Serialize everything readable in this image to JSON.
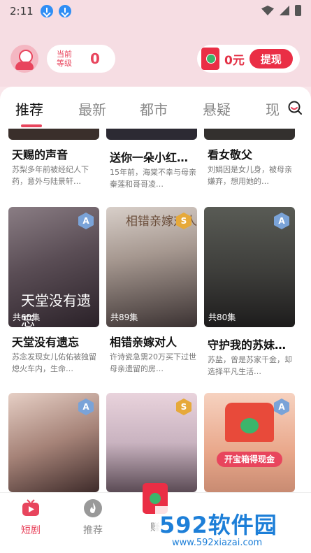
{
  "status_bar": {
    "time": "2:11"
  },
  "header": {
    "level_label": "当前等级",
    "level_value": "0",
    "wallet_amount": "0元",
    "withdraw_label": "提现"
  },
  "tabs": [
    "推荐",
    "最新",
    "都市",
    "悬疑",
    "现"
  ],
  "cards_top": [
    {
      "title": "天赐的声音",
      "desc": "苏梨多年前被经纪人下药，意外与陆景轩…"
    },
    {
      "title": "送你一朵小红…",
      "desc": "15年前，海棠不幸与母亲秦莲和哥哥凌…"
    },
    {
      "title": "看女敬父",
      "desc": "刘娟因是女儿身，被母亲嫌弃，想用她的…"
    }
  ],
  "cards_mid": [
    {
      "title": "天堂没有遗忘",
      "desc": "苏念发现女儿佑佑被独留熄火车内，生命…",
      "episodes": "共60集",
      "badge": "A",
      "overlay": "天堂没有遗忘"
    },
    {
      "title": "相错亲嫁对人",
      "desc": "许诗瓷急需20万买下过世母亲遗留的房…",
      "episodes": "共89集",
      "badge": "S",
      "overlay": "相错亲嫁对人"
    },
    {
      "title": "守护我的苏妹…",
      "desc": "苏盐，曾是苏家千金，却选择平凡生活…",
      "episodes": "共80集",
      "badge": "A",
      "overlay": ""
    }
  ],
  "cards_bottom": [
    {
      "badge": "A"
    },
    {
      "badge": "S"
    },
    {
      "badge": "A",
      "promo": "开宝箱得现金"
    }
  ],
  "bottom_nav": [
    {
      "label": "短剧",
      "icon": "tv-icon"
    },
    {
      "label": "推荐",
      "icon": "flame-icon"
    },
    {
      "label": "赚",
      "icon": "redpacket-icon"
    }
  ],
  "watermark": {
    "main": "592软件园",
    "sub": "www.592xiazai.com"
  },
  "colors": {
    "accent": "#e8455d",
    "red": "#ea2e45",
    "bg": "#f6dde3"
  }
}
